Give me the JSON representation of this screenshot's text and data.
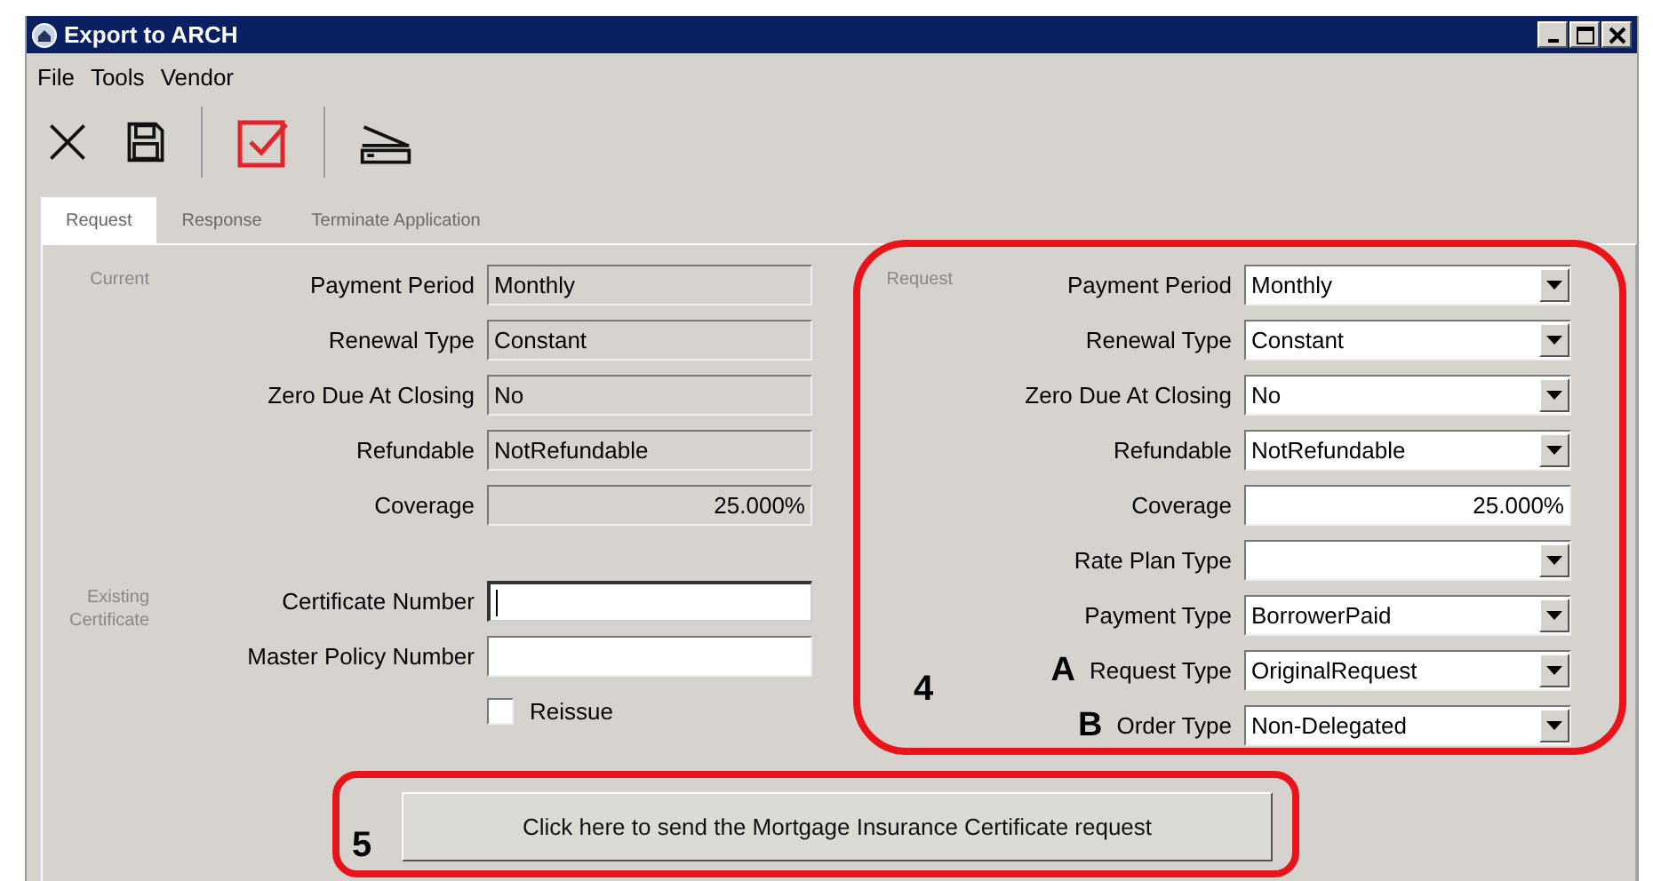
{
  "window": {
    "title": "Export to ARCH"
  },
  "menu": [
    "File",
    "Tools",
    "Vendor"
  ],
  "tabs": [
    {
      "label": "Request",
      "selected": true
    },
    {
      "label": "Response",
      "selected": false
    },
    {
      "label": "Terminate Application",
      "selected": false
    }
  ],
  "current": {
    "label": "Current",
    "fields": [
      {
        "label": "Payment Period",
        "value": "Monthly",
        "kind": "text"
      },
      {
        "label": "Renewal Type",
        "value": "Constant",
        "kind": "text"
      },
      {
        "label": "Zero Due At Closing",
        "value": "No",
        "kind": "text"
      },
      {
        "label": "Refundable",
        "value": "NotRefundable",
        "kind": "text"
      },
      {
        "label": "Coverage",
        "value": "25.000%",
        "kind": "number"
      }
    ]
  },
  "existing": {
    "label": "Existing Certificate",
    "fields": [
      {
        "label": "Certificate Number",
        "focused": true
      },
      {
        "label": "Master Policy Number",
        "focused": false
      }
    ],
    "reissue": {
      "label": "Reissue",
      "checked": false
    }
  },
  "request": {
    "label": "Request",
    "fields": [
      {
        "label": "Payment Period",
        "value": "Monthly",
        "kind": "combo"
      },
      {
        "label": "Renewal Type",
        "value": "Constant",
        "kind": "combo"
      },
      {
        "label": "Zero Due At Closing",
        "value": "No",
        "kind": "combo"
      },
      {
        "label": "Refundable",
        "value": "NotRefundable",
        "kind": "combo"
      },
      {
        "label": "Coverage",
        "value": "25.000%",
        "kind": "number"
      },
      {
        "label": "Rate Plan Type",
        "kind": "combo"
      },
      {
        "label": "Payment Type",
        "value": "BorrowerPaid",
        "kind": "combo"
      },
      {
        "label": "Request Type",
        "value": "OriginalRequest",
        "kind": "combo",
        "marker": "A"
      },
      {
        "label": "Order Type",
        "value": "Non-Delegated",
        "kind": "combo",
        "marker": "B"
      }
    ]
  },
  "send_button": "Click here to send the Mortgage Insurance Certificate request",
  "callouts": {
    "request": "4",
    "button": "5"
  }
}
